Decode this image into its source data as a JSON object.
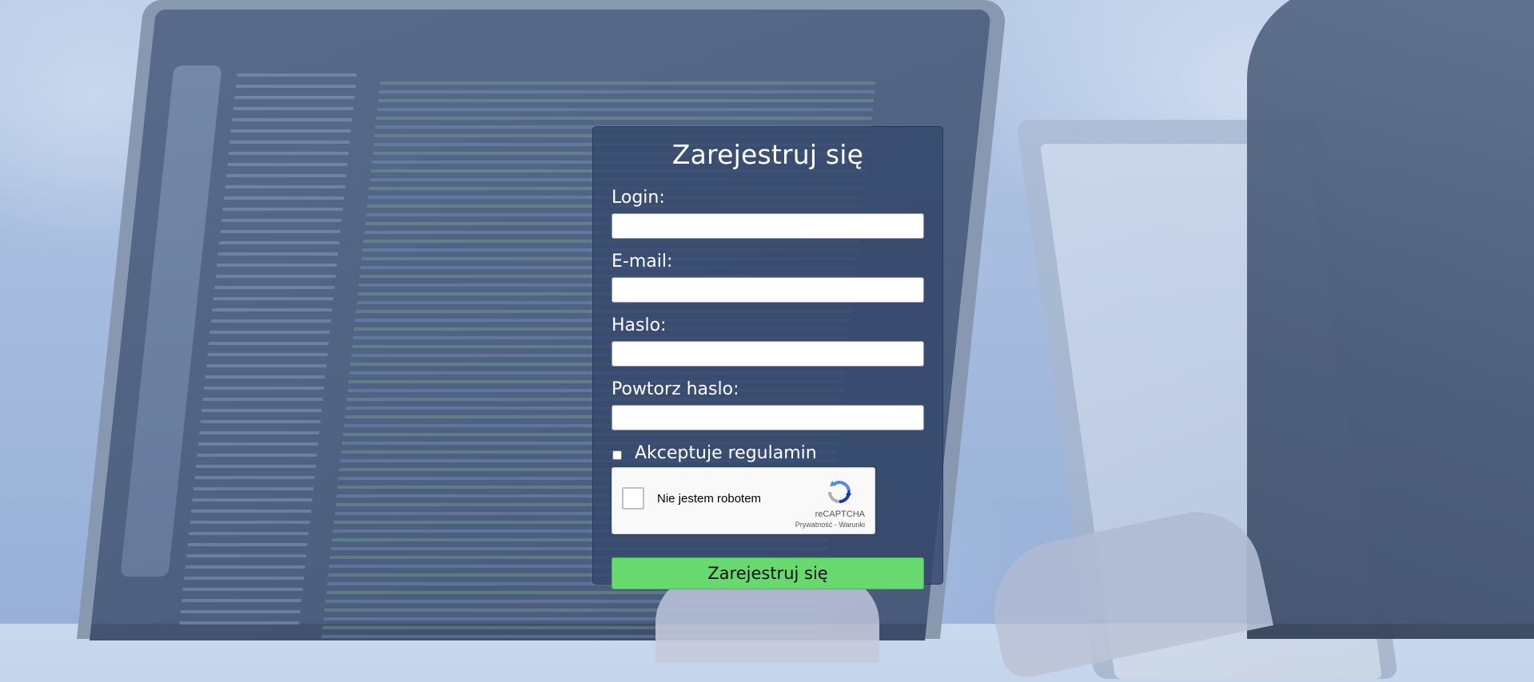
{
  "form": {
    "title": "Zarejestruj się",
    "fields": [
      {
        "label": "Login:",
        "value": "",
        "placeholder": ""
      },
      {
        "label": "E-mail:",
        "value": "",
        "placeholder": ""
      },
      {
        "label": "Haslo:",
        "value": "",
        "placeholder": ""
      },
      {
        "label": "Powtorz haslo:",
        "value": "",
        "placeholder": ""
      }
    ],
    "terms_label": "Akceptuje regulamin",
    "terms_checked": false,
    "recaptcha": {
      "label": "Nie jestem robotem",
      "brand": "reCAPTCHA",
      "privacy_link": "Prywatność",
      "separator": "-",
      "terms_link": "Warunki",
      "checked": false
    },
    "submit_label": "Zarejestruj się"
  },
  "colors": {
    "panel_background": "#34486c",
    "submit_button": "#68d96f",
    "recaptcha_blue": "#4a90e2",
    "recaptcha_gray": "#b0b0b0"
  },
  "icons": [
    "recaptcha-logo-icon",
    "checkbox-icon"
  ]
}
